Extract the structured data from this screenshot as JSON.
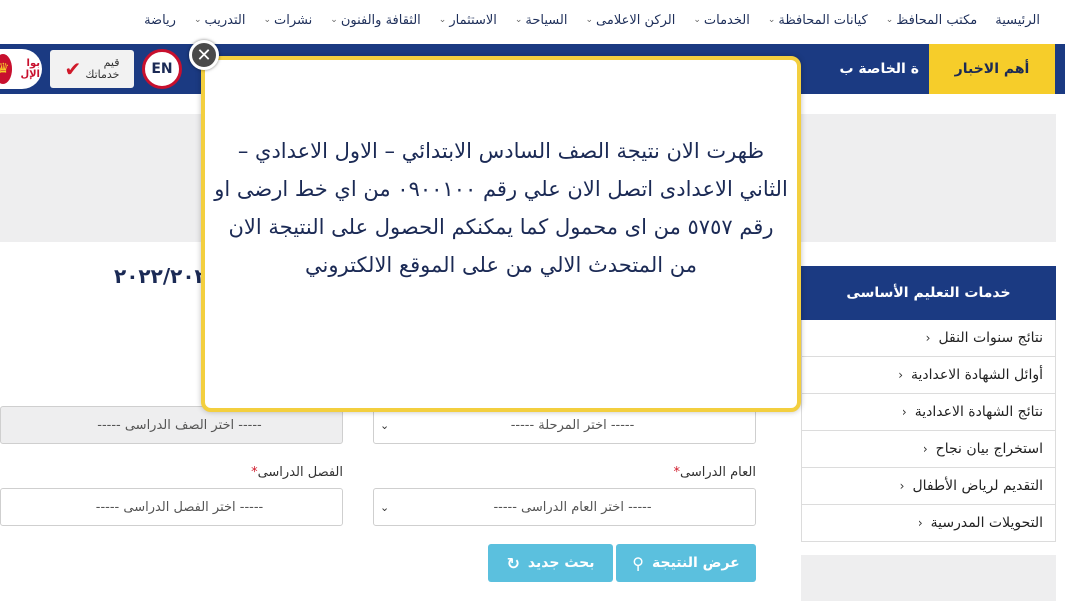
{
  "nav": {
    "items": [
      {
        "label": "الرئيسية",
        "has_dropdown": false
      },
      {
        "label": "مكتب المحافظ",
        "has_dropdown": true
      },
      {
        "label": "كيانات المحافظة",
        "has_dropdown": true
      },
      {
        "label": "الخدمات",
        "has_dropdown": true
      },
      {
        "label": "الركن الاعلامى",
        "has_dropdown": true
      },
      {
        "label": "السياحة",
        "has_dropdown": true
      },
      {
        "label": "الاستثمار",
        "has_dropdown": true
      },
      {
        "label": "الثقافة والفنون",
        "has_dropdown": true
      },
      {
        "label": "نشرات",
        "has_dropdown": true
      },
      {
        "label": "التدريب",
        "has_dropdown": true
      },
      {
        "label": "رياضة",
        "has_dropdown": false
      }
    ]
  },
  "newsbar": {
    "label": "أهم الاخبار",
    "ticker": "ة الخاصة ب",
    "logo_en": "EN",
    "logo_rate_line1": "قيم",
    "logo_rate_line2": "خدماتك",
    "logo_portal_text": "بوا الإل"
  },
  "date_heading": "٢٠٢٢/٢٠٢١",
  "sidebar": {
    "title": "خدمات التعليم الأساسى",
    "items": [
      "نتائج سنوات النقل",
      "أوائل الشهادة الاعدادية",
      "نتائج الشهادة الاعدادية",
      "استخراج بيان نجاح",
      "التقديم لرياض الأطفال",
      "التحويلات المدرسية"
    ]
  },
  "form": {
    "stage_placeholder": "----- اختر المرحلة -----",
    "grade_placeholder": "----- اختر الصف الدراسى -----",
    "year_label": "العام الدراسى",
    "year_placeholder": "----- اختر العام الدراسى -----",
    "term_label": "الفصل الدراسى",
    "term_placeholder": "----- اختر الفصل الدراسى -----",
    "required_mark": "*",
    "show_result_label": "عرض النتيجة",
    "new_search_label": "بحث جديد"
  },
  "popup": {
    "message": "ظهرت الان نتيجة الصف السادس الابتدائي – الاول الاعدادي – الثاني الاعدادى اتصل الان علي رقم ٠٩٠٠١٠٠ من اي خط ارضى او رقم ٥٧٥٧ من اى محمول كما يمكنكم الحصول على النتيجة الان من المتحدث الالي من على الموقع الالكتروني",
    "close_glyph": "✕"
  },
  "colors": {
    "navy": "#1b3a82",
    "accent_yellow": "#f6cd2a",
    "button_blue": "#5bc0de"
  }
}
